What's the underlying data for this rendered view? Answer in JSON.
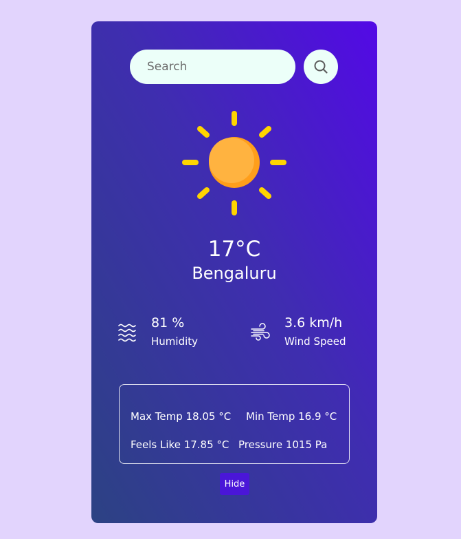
{
  "search": {
    "placeholder": "Search",
    "value": "",
    "button_icon": "search-icon"
  },
  "weather": {
    "icon": "sun-icon",
    "temperature": "17°C",
    "city": "Bengaluru"
  },
  "stats": {
    "humidity": {
      "icon": "humidity-waves-icon",
      "value": "81 %",
      "label": "Humidity"
    },
    "wind": {
      "icon": "wind-icon",
      "value": "3.6 km/h",
      "label": "Wind Speed"
    }
  },
  "details": {
    "max_temp": "Max Temp 18.05 °C",
    "min_temp": "Min Temp 16.9 °C",
    "feels_like": "Feels Like 17.85 °C",
    "pressure": "Pressure 1015 Pa"
  },
  "toggle": {
    "label": "Hide"
  },
  "colors": {
    "page_background": "#e2d4fd",
    "card_gradient_start": "#2c4283",
    "card_gradient_end": "#5309e6",
    "input_background": "#ecfff9",
    "sun_core": "#ffb340",
    "sun_rays": "#ffd400",
    "hide_button": "#4a16d8"
  }
}
